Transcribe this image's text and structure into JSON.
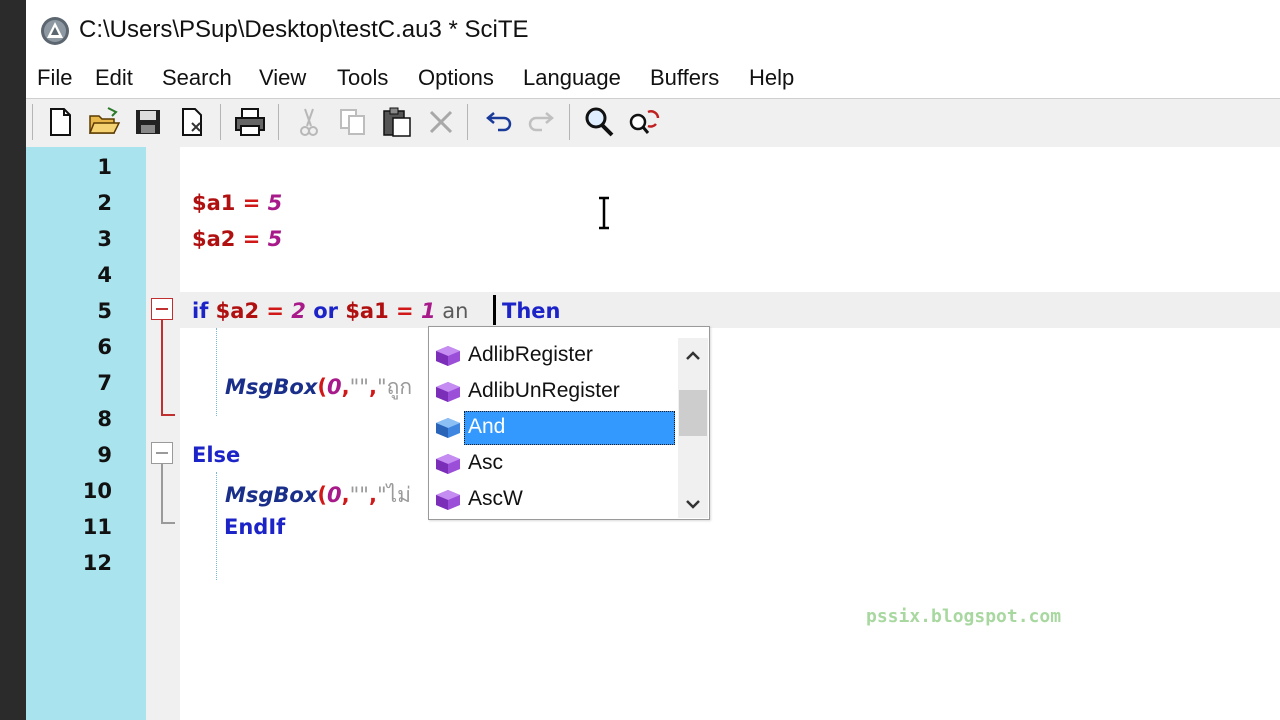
{
  "window": {
    "title": "C:\\Users\\PSup\\Desktop\\testC.au3 * SciTE"
  },
  "menu": {
    "items": [
      "File",
      "Edit",
      "Search",
      "View",
      "Tools",
      "Options",
      "Language",
      "Buffers",
      "Help"
    ]
  },
  "toolbar": {
    "buttons": [
      "new-file-icon",
      "open-folder-icon",
      "save-icon",
      "close-file-icon",
      "print-icon",
      "cut-icon",
      "copy-icon",
      "paste-icon",
      "delete-icon",
      "undo-icon",
      "redo-icon",
      "find-icon",
      "replace-icon"
    ]
  },
  "editor": {
    "line_numbers": [
      "1",
      "2",
      "3",
      "4",
      "5",
      "6",
      "7",
      "8",
      "9",
      "10",
      "11",
      "12"
    ],
    "lines": {
      "l2": {
        "var": "$a1",
        "op": " = ",
        "num": "5"
      },
      "l3": {
        "var": "$a2",
        "op": " = ",
        "num": "5"
      },
      "l5": {
        "kw_if": "if ",
        "var1": "$a2",
        "op1": " = ",
        "num1": "2",
        "kw_or": " or ",
        "var2": "$a1",
        "op2": " = ",
        "num2": "1",
        "typed": " an",
        "kw_then": "Then"
      },
      "l7": {
        "fn": "MsgBox",
        "paren": "(",
        "num": "0",
        "comma1": ",",
        "str1": "\"\"",
        "comma2": ",",
        "str2": "\"ถูก"
      },
      "l9": {
        "kw": "Else"
      },
      "l10": {
        "fn": "MsgBox",
        "paren": "(",
        "num": "0",
        "comma1": ",",
        "str1": "\"\"",
        "comma2": ",",
        "str2": "\"ไม่"
      },
      "l11": {
        "kw": "EndIf"
      }
    }
  },
  "autocomplete": {
    "items": [
      "AdlibRegister",
      "AdlibUnRegister",
      "And",
      "Asc",
      "AscW"
    ],
    "selected": "And",
    "scroll_up": "⌃",
    "scroll_down": "⌄"
  },
  "watermark": "pssix.blogspot.com",
  "colors": {
    "gutter": "#a9e3ee",
    "selection": "#3399ff",
    "keyword": "#1c24c8",
    "variable": "#b01010",
    "number": "#a81a8a"
  }
}
